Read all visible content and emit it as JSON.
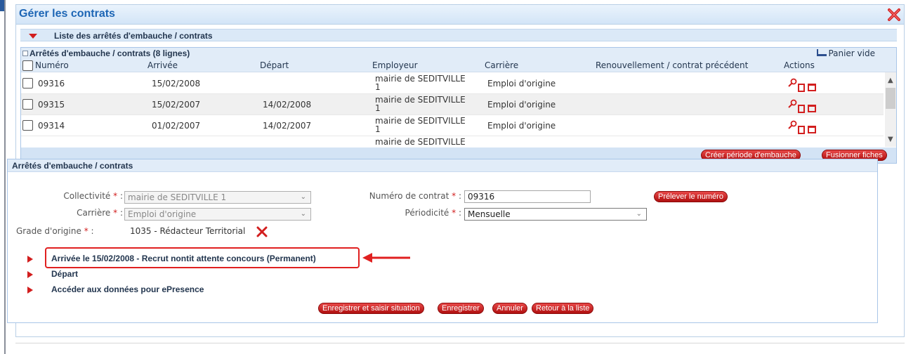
{
  "window": {
    "title": "Gérer les contrats",
    "close_icon": "close-icon"
  },
  "list_section": {
    "label": "Liste des arrêtés d'embauche / contrats"
  },
  "grid": {
    "caption": "Arrêtés d'embauche / contrats (8 lignes)",
    "cart_label": "Panier vide",
    "columns": [
      "Numéro",
      "Arrivée",
      "Départ",
      "Employeur",
      "Carrière",
      "Renouvellement / contrat précédent",
      "Actions"
    ],
    "rows": [
      {
        "numero": "09316",
        "arrivee": "15/02/2008",
        "depart": "",
        "employeur": "mairie de SEDITVILLE 1",
        "carriere": "Emploi d'origine",
        "renouvellement": ""
      },
      {
        "numero": "09315",
        "arrivee": "15/02/2007",
        "depart": "14/02/2008",
        "employeur": "mairie de SEDITVILLE 1",
        "carriere": "Emploi d'origine",
        "renouvellement": ""
      },
      {
        "numero": "09314",
        "arrivee": "01/02/2007",
        "depart": "14/02/2007",
        "employeur": "mairie de SEDITVILLE 1",
        "carriere": "Emploi d'origine",
        "renouvellement": ""
      }
    ],
    "partial_row_employeur": "mairie de SEDITVILLE",
    "buttons": {
      "create": "Créer période d'embauche",
      "merge": "Fusionner fiches"
    }
  },
  "form": {
    "section_label": "Arrêtés d'embauche / contrats",
    "collectivite": {
      "label": "Collectivité",
      "value": "mairie de SEDITVILLE 1"
    },
    "carriere": {
      "label": "Carrière",
      "value": "Emploi d'origine"
    },
    "grade": {
      "label": "Grade d'origine",
      "value": "1035 - Rédacteur Territorial"
    },
    "numero_contrat": {
      "label": "Numéro de contrat",
      "value": "09316"
    },
    "prelever": "Prélever le numéro",
    "periodicite": {
      "label": "Périodicité",
      "value": "Mensuelle"
    },
    "required_mark": "*",
    "colon": ":",
    "expanders": [
      "Arrivée le 15/02/2008 - Recrut nontit attente concours (Permanent)",
      "Départ",
      "Accéder aux données pour ePresence"
    ],
    "buttons": {
      "save_situation": "Enregistrer et saisir situation",
      "save": "Enregistrer",
      "cancel": "Annuler",
      "back": "Retour à la liste"
    }
  },
  "colors": {
    "accent_red": "#d21e1e",
    "title_blue": "#1d66b5",
    "header_bg": "#dbe9f7"
  }
}
